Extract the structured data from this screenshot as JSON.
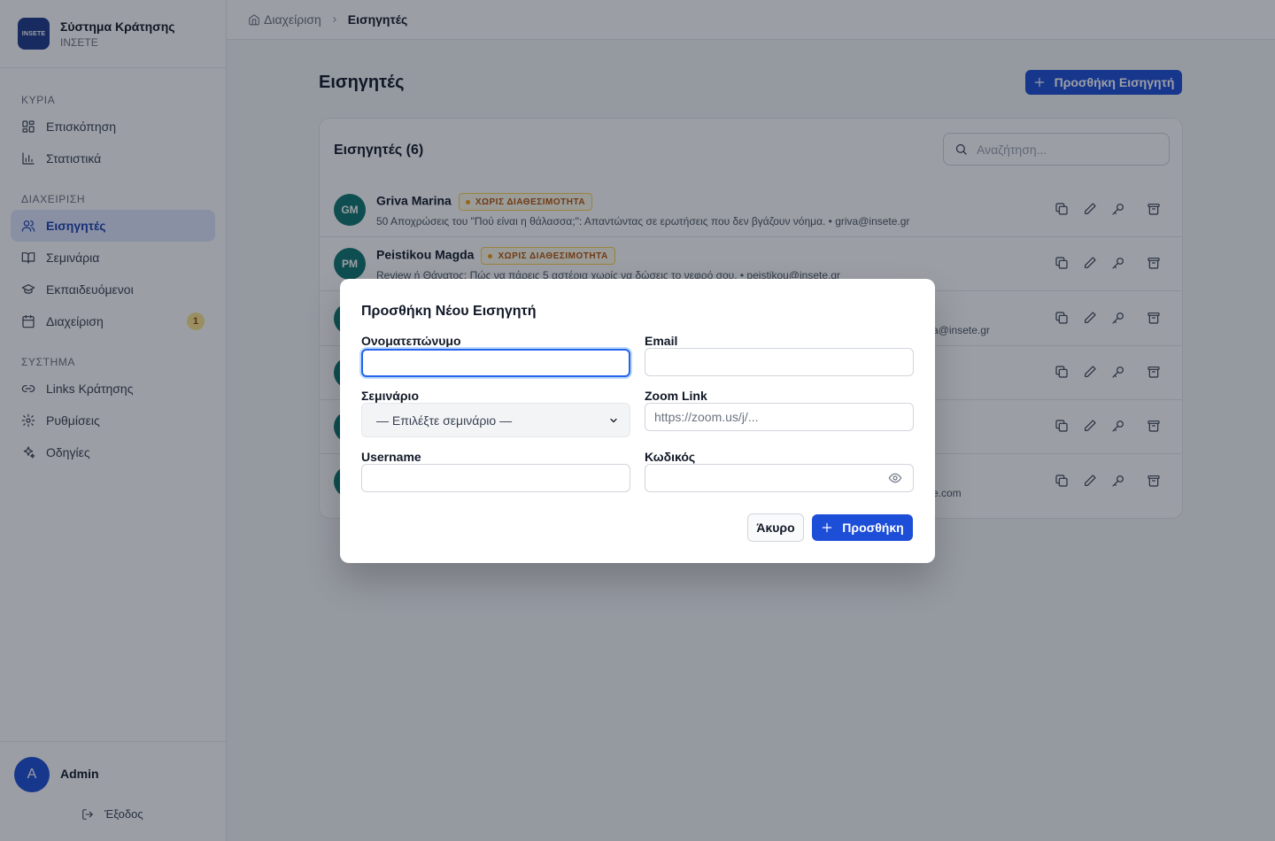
{
  "app": {
    "logo_text": "INSETE",
    "title": "Σύστημα Κράτησης",
    "subtitle": "INΣΕΤΕ"
  },
  "sidebar": {
    "sections": [
      {
        "label": "ΚΥΡΙΑ"
      },
      {
        "label": "ΔΙΑΧΕΙΡΙΣΗ"
      },
      {
        "label": "ΣΥΣΤΗΜΑ"
      }
    ],
    "items": [
      {
        "label": "Επισκόπηση",
        "icon": "dashboard-icon"
      },
      {
        "label": "Στατιστικά",
        "icon": "bar-chart-icon"
      },
      {
        "label": "Εισηγητές",
        "icon": "users-icon",
        "active": true
      },
      {
        "label": "Σεμινάρια",
        "icon": "book-icon"
      },
      {
        "label": "Εκπαιδευόμενοι",
        "icon": "graduation-cap-icon"
      },
      {
        "label": "Διαχείριση",
        "icon": "calendar-icon",
        "badge": "1"
      },
      {
        "label": "Links Κράτησης",
        "icon": "link-icon"
      },
      {
        "label": "Ρυθμίσεις",
        "icon": "gear-icon"
      },
      {
        "label": "Οδηγίες",
        "icon": "sparkles-icon"
      }
    ]
  },
  "user": {
    "initial": "A",
    "name": "Admin",
    "logout": "Έξοδος"
  },
  "breadcrumb": {
    "home": "Διαχείριση",
    "current": "Εισηγητές"
  },
  "page": {
    "title": "Εισηγητές",
    "add_button": "Προσθήκη Εισηγητή",
    "list_title": "Εισηγητές (6)",
    "search_placeholder": "Αναζήτηση..."
  },
  "rows": [
    {
      "initials": "GM",
      "name": "Griva Marina",
      "badge": "ΧΩΡΙΣ ΔΙΑΘΕΣΙΜΟΤΗΤΑ",
      "meta": "50 Αποχρώσεις του \"Πού είναι η θάλασσα;\": Απαντώντας σε ερωτήσεις που δεν βγάζουν νόημα. • griva@insete.gr"
    },
    {
      "initials": "PM",
      "name": "Peistikou Magda",
      "badge": "ΧΩΡΙΣ ΔΙΑΘΕΣΙΜΟΤΗΤΑ",
      "meta": "Review ή Θάνατος: Πώς να πάρεις 5 αστέρια χωρίς να δώσεις το νεφρό σου. • peistikou@insete.gr"
    },
    {
      "initials": "",
      "name": "",
      "badge": "",
      "meta": "a@insete.gr"
    },
    {
      "initials": "",
      "name": "",
      "badge": "",
      "meta": ""
    },
    {
      "initials": "",
      "name": "",
      "badge": "",
      "meta": ""
    },
    {
      "initials": "",
      "name": "",
      "badge": "",
      "meta": "e.com"
    }
  ],
  "modal": {
    "title": "Προσθήκη Νέου Εισηγητή",
    "fullname_label": "Ονοματεπώνυμο",
    "email_label": "Email",
    "seminar_label": "Σεμινάριο",
    "seminar_value": "— Επιλέξτε σεμινάριο —",
    "zoom_label": "Zoom Link",
    "zoom_placeholder": "https://zoom.us/j/...",
    "username_label": "Username",
    "password_label": "Κωδικός",
    "cancel": "Άκυρο",
    "submit": "Προσθήκη"
  },
  "colors": {
    "primary": "#1d4ed8",
    "badge_warning": "#b45309",
    "avatar_teal": "#0f766e"
  }
}
